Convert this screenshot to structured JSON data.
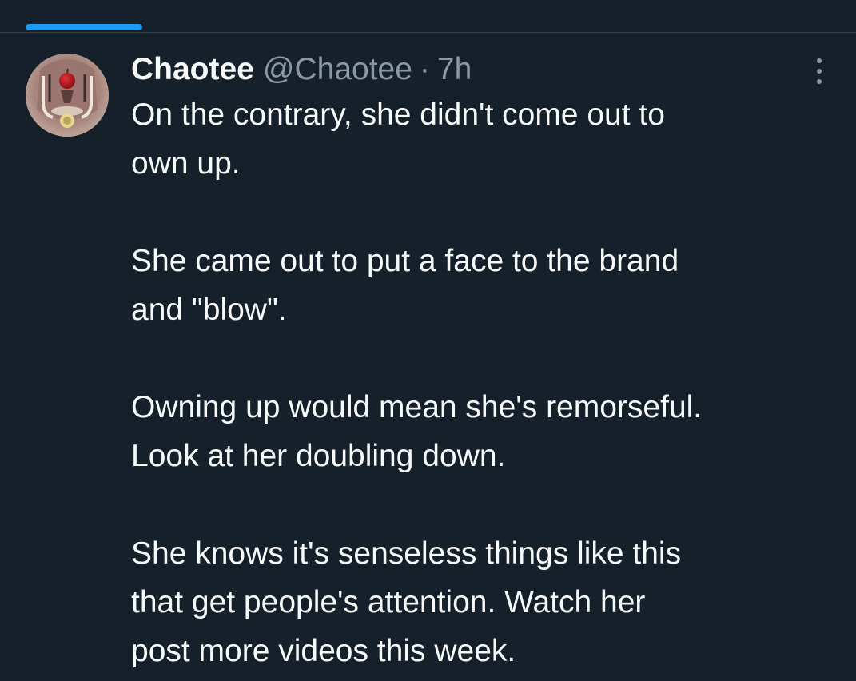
{
  "top_partial_text": "ʹ ʹ ʹ ʹ",
  "tweet": {
    "display_name": "Chaotee",
    "handle": "@Chaotee",
    "separator": "·",
    "time": "7h",
    "paragraphs": [
      "On the contrary, she didn't come out to\nown up.",
      "She came out to put a face to the brand\nand \"blow\".",
      "Owning up would mean she's remorseful.\nLook at her doubling down.",
      "She knows it's senseless things like this\nthat get people's attention. Watch her\npost more videos this week."
    ]
  },
  "icons": {
    "more": "more-vertical-icon",
    "avatar": "apple-mirror-avatar"
  },
  "colors": {
    "background": "#15202b",
    "accent": "#1d9bf0",
    "text_primary": "#f7f9f9",
    "text_secondary": "#8b98a5",
    "divider": "#38444d"
  }
}
